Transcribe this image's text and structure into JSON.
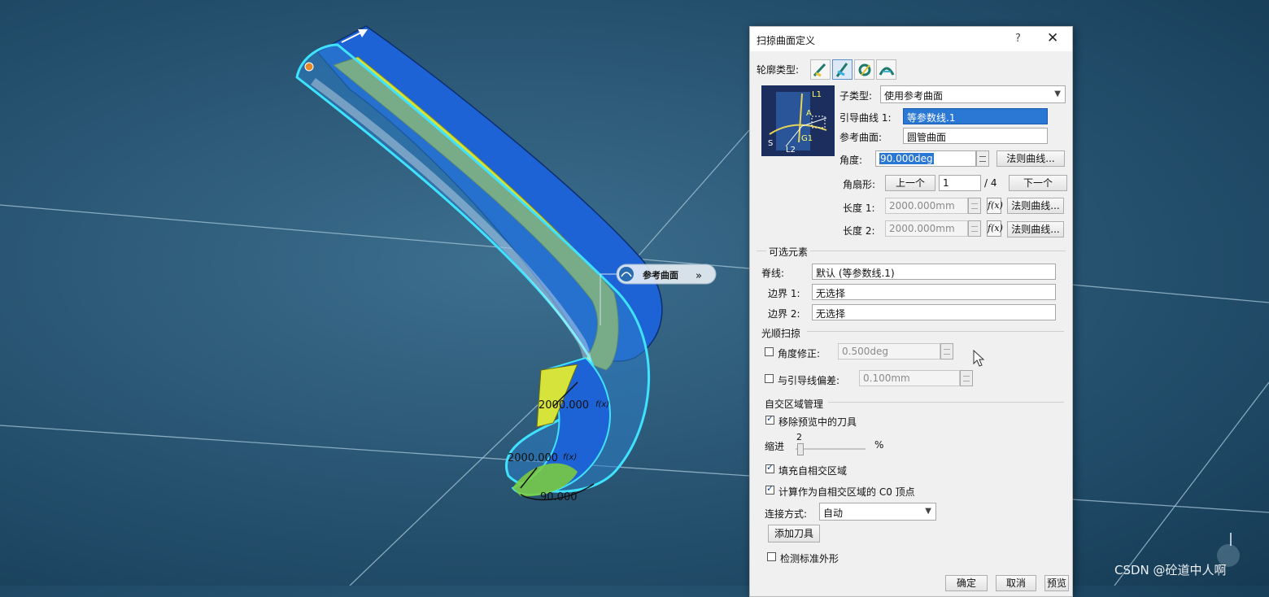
{
  "viewport": {
    "tag_label": "参考曲面",
    "tag_hint": "»",
    "dim_top": "2000.000",
    "dim_left": "2000.000",
    "dim_bottom": "90.000",
    "fx_glyph": "f(x)"
  },
  "dialog": {
    "title": "扫掠曲面定义",
    "help": "?",
    "close": "✕",
    "profile_type_label": "轮廓类型:",
    "profile_types": [
      "explicit-icon",
      "line-icon",
      "circle-icon",
      "conic-icon"
    ],
    "diagram_labels": {
      "l1": "L1",
      "a": "A",
      "s": "S",
      "g1": "G1",
      "l2": "L2"
    },
    "subtype_label": "子类型:",
    "subtype_value": "使用参考曲面",
    "guide_label": "引导曲线 1:",
    "guide_value": "等参数线.1",
    "ref_label": "参考曲面:",
    "ref_value": "圆管曲面",
    "angle_label": "角度:",
    "angle_value": "90.000deg",
    "law_button": "法则曲线...",
    "sector_label": "角扇形:",
    "prev_button": "上一个",
    "sector_value": "1",
    "sector_total": "/ 4",
    "next_button": "下一个",
    "length1_label": "长度 1:",
    "length1_value": "2000.000mm",
    "length2_label": "长度 2:",
    "length2_value": "2000.000mm",
    "fx": "f(x)",
    "optional_title": "可选元素",
    "spine_label": "脊线:",
    "spine_value": "默认 (等参数线.1)",
    "border1_label": "边界 1:",
    "border1_value": "无选择",
    "border2_label": "边界 2:",
    "border2_value": "无选择",
    "smooth_title": "光顺扫掠",
    "angle_corr_label": "角度修正:",
    "angle_corr_value": "0.500deg",
    "angle_corr_checked": false,
    "deviation_label": "与引导线偏差:",
    "deviation_value": "0.100mm",
    "deviation_checked": false,
    "self_title": "自交区域管理",
    "remove_tools_label": "移除预览中的刀具",
    "remove_tools_checked": true,
    "shrink_label": "缩进",
    "shrink_value": "2",
    "shrink_unit": "%",
    "fill_label": "填充自相交区域",
    "fill_checked": true,
    "compute_label": "计算作为自相交区域的 C0 顶点",
    "compute_checked": true,
    "connect_label": "连接方式:",
    "connect_value": "自动",
    "add_tool_button": "添加刀具",
    "canonical_label": "检测标准外形",
    "canonical_checked": false,
    "ok_button": "确定",
    "cancel_button": "取消",
    "preview_button": "预览"
  },
  "watermark": "CSDN @砼道中人啊",
  "colors": {
    "background": "#2a5775",
    "surface_blue": "#1e63d6",
    "surface_yellow": "#d5e33a",
    "highlight_cyan": "#3fe3ff",
    "selection": "#2b78d4"
  }
}
